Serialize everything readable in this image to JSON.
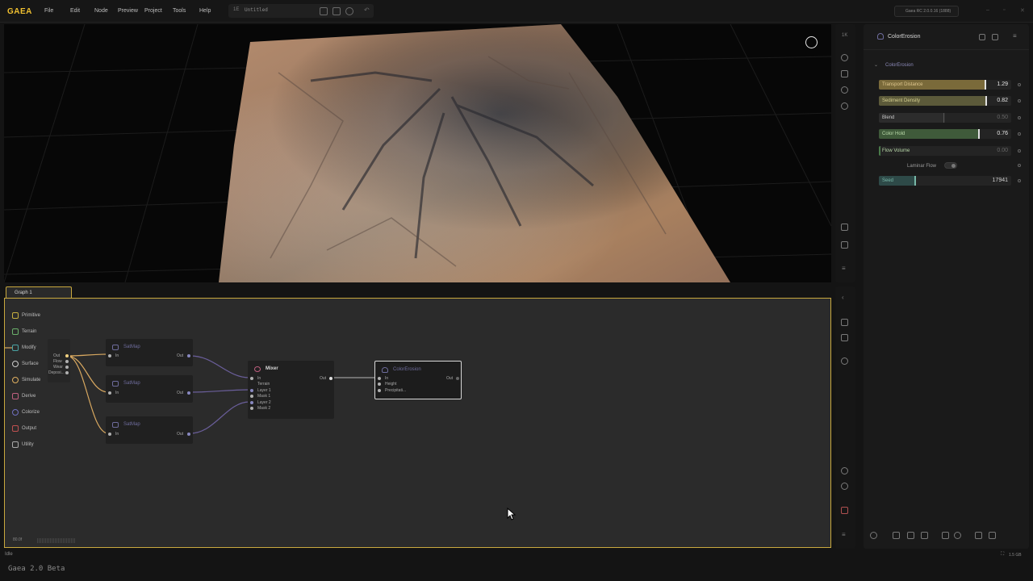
{
  "app": {
    "logo": "GAEA",
    "version": "Gaea RC 2.0.0.16 (1888)",
    "footer": "Gaea 2.0 Beta",
    "status": "Idle",
    "memory": "1.5 GB"
  },
  "menu": [
    "File",
    "Edit",
    "Node",
    "Preview",
    "Project",
    "Tools",
    "Help"
  ],
  "document": {
    "name": "Untitled",
    "icon": "1E"
  },
  "graph": {
    "tab_label": "Graph 1",
    "footer_label": "80.0f",
    "palette": [
      {
        "label": "Primitive",
        "color": "#c8b040"
      },
      {
        "label": "Terrain",
        "color": "#6bb06b"
      },
      {
        "label": "Modify",
        "color": "#4aa3a3"
      },
      {
        "label": "Surface",
        "color": "#cfcfcf"
      },
      {
        "label": "Simulate",
        "color": "#e0b060"
      },
      {
        "label": "Derive",
        "color": "#c06080"
      },
      {
        "label": "Colorize",
        "color": "#7070c0"
      },
      {
        "label": "Output",
        "color": "#c05050"
      },
      {
        "label": "Utility",
        "color": "#aaaaaa"
      }
    ],
    "source_node": {
      "outputs": [
        "Out",
        "Flow",
        "Wear",
        "Deposi..."
      ]
    },
    "satmaps": [
      {
        "title": "SatMap",
        "in": "In",
        "out": "Out"
      },
      {
        "title": "SatMap",
        "in": "In",
        "out": "Out"
      },
      {
        "title": "SatMap",
        "in": "In",
        "out": "Out"
      }
    ],
    "mixer": {
      "title": "Mixer",
      "inputs": [
        "In",
        "Terrain",
        "Layer 1",
        "Mask 1",
        "Layer 2",
        "Mask 2"
      ],
      "out": "Out"
    },
    "colorerosion": {
      "title": "ColorErosion",
      "inputs": [
        "In",
        "Height",
        "Precipitati..."
      ],
      "out": "Out"
    }
  },
  "properties": {
    "node_title": "ColorErosion",
    "section": "ColorErosion",
    "params": [
      {
        "label": "Transport Distance",
        "value": "1.29",
        "fill": 0.81,
        "color": "#7a6a3a",
        "label_color": "#e0c890"
      },
      {
        "label": "Sediment Density",
        "value": "0.82",
        "fill": 0.82,
        "color": "#5c5a3a",
        "label_color": "#d6d090"
      },
      {
        "label": "Blend",
        "value": "0.50",
        "fill": 0.5,
        "color": "#2c2c2c",
        "label_color": "#c8c8c8"
      },
      {
        "label": "Color Hold",
        "value": "0.76",
        "fill": 0.76,
        "color": "#3f5a3a",
        "label_color": "#b8d8a8"
      },
      {
        "label": "Flow Volume",
        "value": "0.00",
        "fill": 0.0,
        "color": "#2c2c2c",
        "label_color": "#b8d8a8"
      }
    ],
    "laminar_flow": {
      "label": "Laminar Flow",
      "on": false
    },
    "seed": {
      "label": "Seed",
      "value": "17941",
      "fill": 0.28,
      "color": "#2e4a48",
      "label_color": "#78b8a8"
    }
  }
}
